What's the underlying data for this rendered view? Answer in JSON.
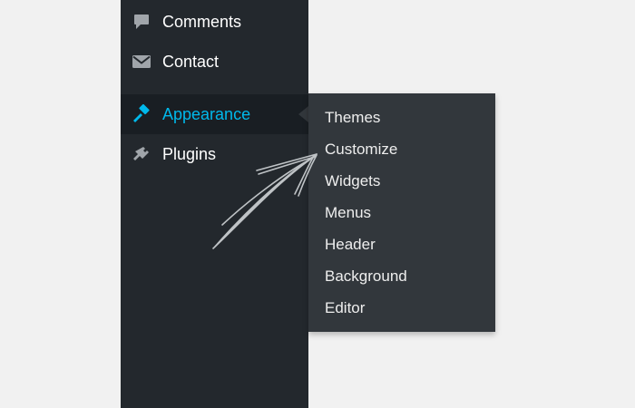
{
  "sidebar": {
    "items": [
      {
        "label": "Comments",
        "icon": "comment-icon"
      },
      {
        "label": "Contact",
        "icon": "envelope-icon"
      },
      {
        "label": "Appearance",
        "icon": "paintbrush-icon",
        "active": true
      },
      {
        "label": "Plugins",
        "icon": "plugin-icon"
      }
    ]
  },
  "appearance_submenu": {
    "items": [
      {
        "label": "Themes"
      },
      {
        "label": "Customize"
      },
      {
        "label": "Widgets"
      },
      {
        "label": "Menus"
      },
      {
        "label": "Header"
      },
      {
        "label": "Background"
      },
      {
        "label": "Editor"
      }
    ]
  },
  "colors": {
    "sidebar_bg": "#23282d",
    "active_bg": "#191e23",
    "active_text": "#00b9eb",
    "submenu_bg": "#32373c",
    "page_bg": "#f1f1f1"
  }
}
